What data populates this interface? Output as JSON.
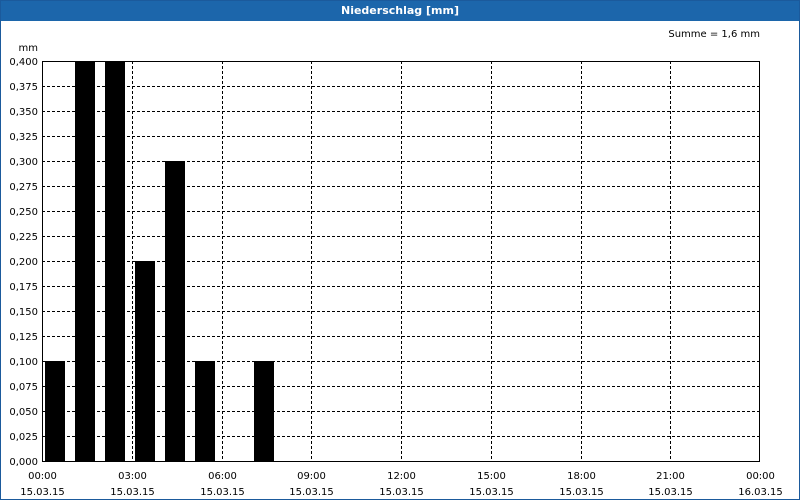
{
  "window": {
    "title": "Niederschlag [mm]"
  },
  "chart_data": {
    "type": "bar",
    "title": "Niederschlag [mm]",
    "ylabel": "mm",
    "summary": "Summe = 1,6 mm",
    "ylim": [
      0,
      0.4
    ],
    "yticks": [
      "0,000",
      "0,025",
      "0,050",
      "0,075",
      "0,100",
      "0,125",
      "0,150",
      "0,175",
      "0,200",
      "0,225",
      "0,250",
      "0,275",
      "0,300",
      "0,325",
      "0,350",
      "0,375",
      "0,400"
    ],
    "xlim_hours": [
      0,
      24
    ],
    "xticks": [
      {
        "time": "00:00",
        "date": "15.03.15"
      },
      {
        "time": "03:00",
        "date": "15.03.15"
      },
      {
        "time": "06:00",
        "date": "15.03.15"
      },
      {
        "time": "09:00",
        "date": "15.03.15"
      },
      {
        "time": "12:00",
        "date": "15.03.15"
      },
      {
        "time": "15:00",
        "date": "15.03.15"
      },
      {
        "time": "18:00",
        "date": "15.03.15"
      },
      {
        "time": "21:00",
        "date": "15.03.15"
      },
      {
        "time": "00:00",
        "date": "16.03.15"
      }
    ],
    "x": [
      "00:00",
      "01:00",
      "02:00",
      "03:00",
      "04:00",
      "05:00",
      "06:00",
      "07:00"
    ],
    "values": [
      0.1,
      0.4,
      0.4,
      0.2,
      0.3,
      0.1,
      0.0,
      0.1
    ],
    "grid": true,
    "bar_color": "#000000",
    "grid_color": "#000000"
  }
}
